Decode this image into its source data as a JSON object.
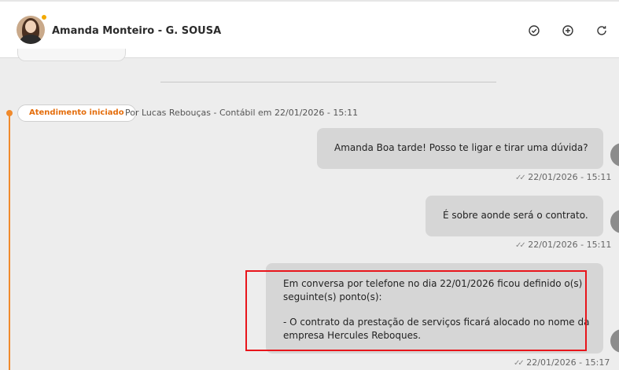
{
  "header": {
    "contact_name": "Amanda Monteiro - G. SOUSA",
    "avatar_status_color": "#f2a900",
    "icons": [
      "check-circle-icon",
      "plus-circle-icon",
      "refresh-icon"
    ]
  },
  "event": {
    "badge": "Atendimento iniciado",
    "text": "Por Lucas Rebouças - Contábil em 22/01/2026 - 15:11",
    "accent_color": "#e46d0c"
  },
  "messages": [
    {
      "text": "Amanda Boa tarde! Posso te ligar e tirar uma dúvida?",
      "time": "22/01/2026 - 15:11"
    },
    {
      "text": "É sobre aonde será o contrato.",
      "time": "22/01/2026 - 15:11"
    },
    {
      "lines": [
        "Em conversa por telefone no dia 22/01/2026 ficou definido o(s)",
        "seguinte(s) ponto(s):",
        "",
        "- O contrato da prestação de serviços ficará alocado no nome da",
        "empresa Hercules Reboques."
      ],
      "time": "22/01/2026 - 15:17"
    }
  ],
  "ticks": "✓✓",
  "highlight_color": "#e8151b"
}
